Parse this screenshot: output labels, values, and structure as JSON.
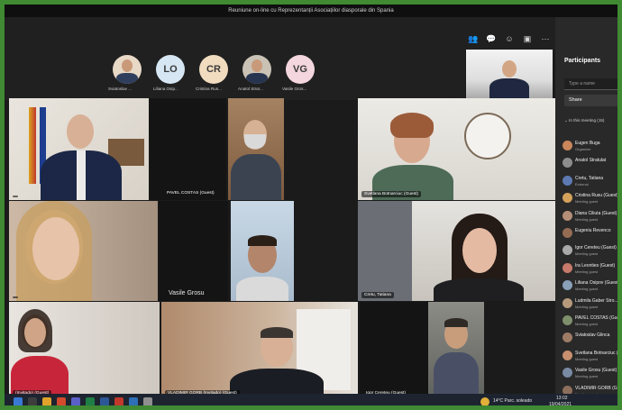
{
  "window": {
    "title": "Reuniune on-line cu Reprezentanții Asociațiilor diasporale din Spania"
  },
  "toolbar": {
    "icons": [
      "participants-icon",
      "chat-icon",
      "reactions-icon",
      "rooms-icon",
      "more-icon",
      "camera-icon",
      "mic-icon",
      "share-icon"
    ],
    "leave_color": "#c4314b"
  },
  "avatars": [
    {
      "initials": "",
      "label": "Sviatoslav ...",
      "mic": "🎙"
    },
    {
      "initials": "LO",
      "label": "Liliana Osip...",
      "mic": "🎙"
    },
    {
      "initials": "CR",
      "label": "Cristina Rus...",
      "mic": "🎙"
    },
    {
      "initials": "",
      "label": "Anatol Strat...",
      "mic": "🎙"
    },
    {
      "initials": "VG",
      "label": "Vasile Gros...",
      "mic": "🎙"
    }
  ],
  "tiles": {
    "t1": "",
    "t2": "PAVEL COSTAS (Guest)",
    "t3": "Svetlana Botnarciuc (Guest)",
    "t4": "",
    "t5": "Vasile Grosu",
    "t6": "Cretu, Tatiana",
    "t7": "(Invitado) (Guest)",
    "t8": "VLADIMIR GORB (Invitado) (Guest)",
    "t9": "Igor Ceretеu (Guest)",
    "t10": ""
  },
  "panel": {
    "title": "Participants",
    "search_placeholder": "Type a name",
    "share_label": "Share",
    "section": "In this meeting (15)",
    "people": [
      {
        "name": "Eugen Bugа",
        "role": "Organizer"
      },
      {
        "name": "Anatol Stratulat",
        "role": ""
      },
      {
        "name": "Cretu, Tatiana",
        "role": "External"
      },
      {
        "name": "Cristina Rusu (Guest)",
        "role": "Meeting guest"
      },
      {
        "name": "Diana Ciliuta (Guest)",
        "role": "Meeting guest"
      },
      {
        "name": "Eugeniu Revenco",
        "role": ""
      },
      {
        "name": "Igor Ceretеu (Guest)",
        "role": "Meeting guest"
      },
      {
        "name": "Ira Leonties (Guest)",
        "role": "Meeting guest"
      },
      {
        "name": "Liliana Osipov (Guest)",
        "role": "Meeting guest"
      },
      {
        "name": "Ludmila Gaber Stro...",
        "role": "Meeting guest"
      },
      {
        "name": "PAVEL COSTAS (Guest)",
        "role": "Meeting guest"
      },
      {
        "name": "Sviatoslav Glinca",
        "role": ""
      },
      {
        "name": "Svetlana Botnarciuc (Guest)",
        "role": "Meeting guest"
      },
      {
        "name": "Vasile Grosu (Guest)",
        "role": "Meeting guest"
      },
      {
        "name": "VLADIMIR GORB (Guest)",
        "role": "Meeting guest"
      }
    ]
  },
  "taskbar": {
    "weather": "14°C  Parc. soleado",
    "time": "13:02",
    "date": "19/04/2021"
  }
}
